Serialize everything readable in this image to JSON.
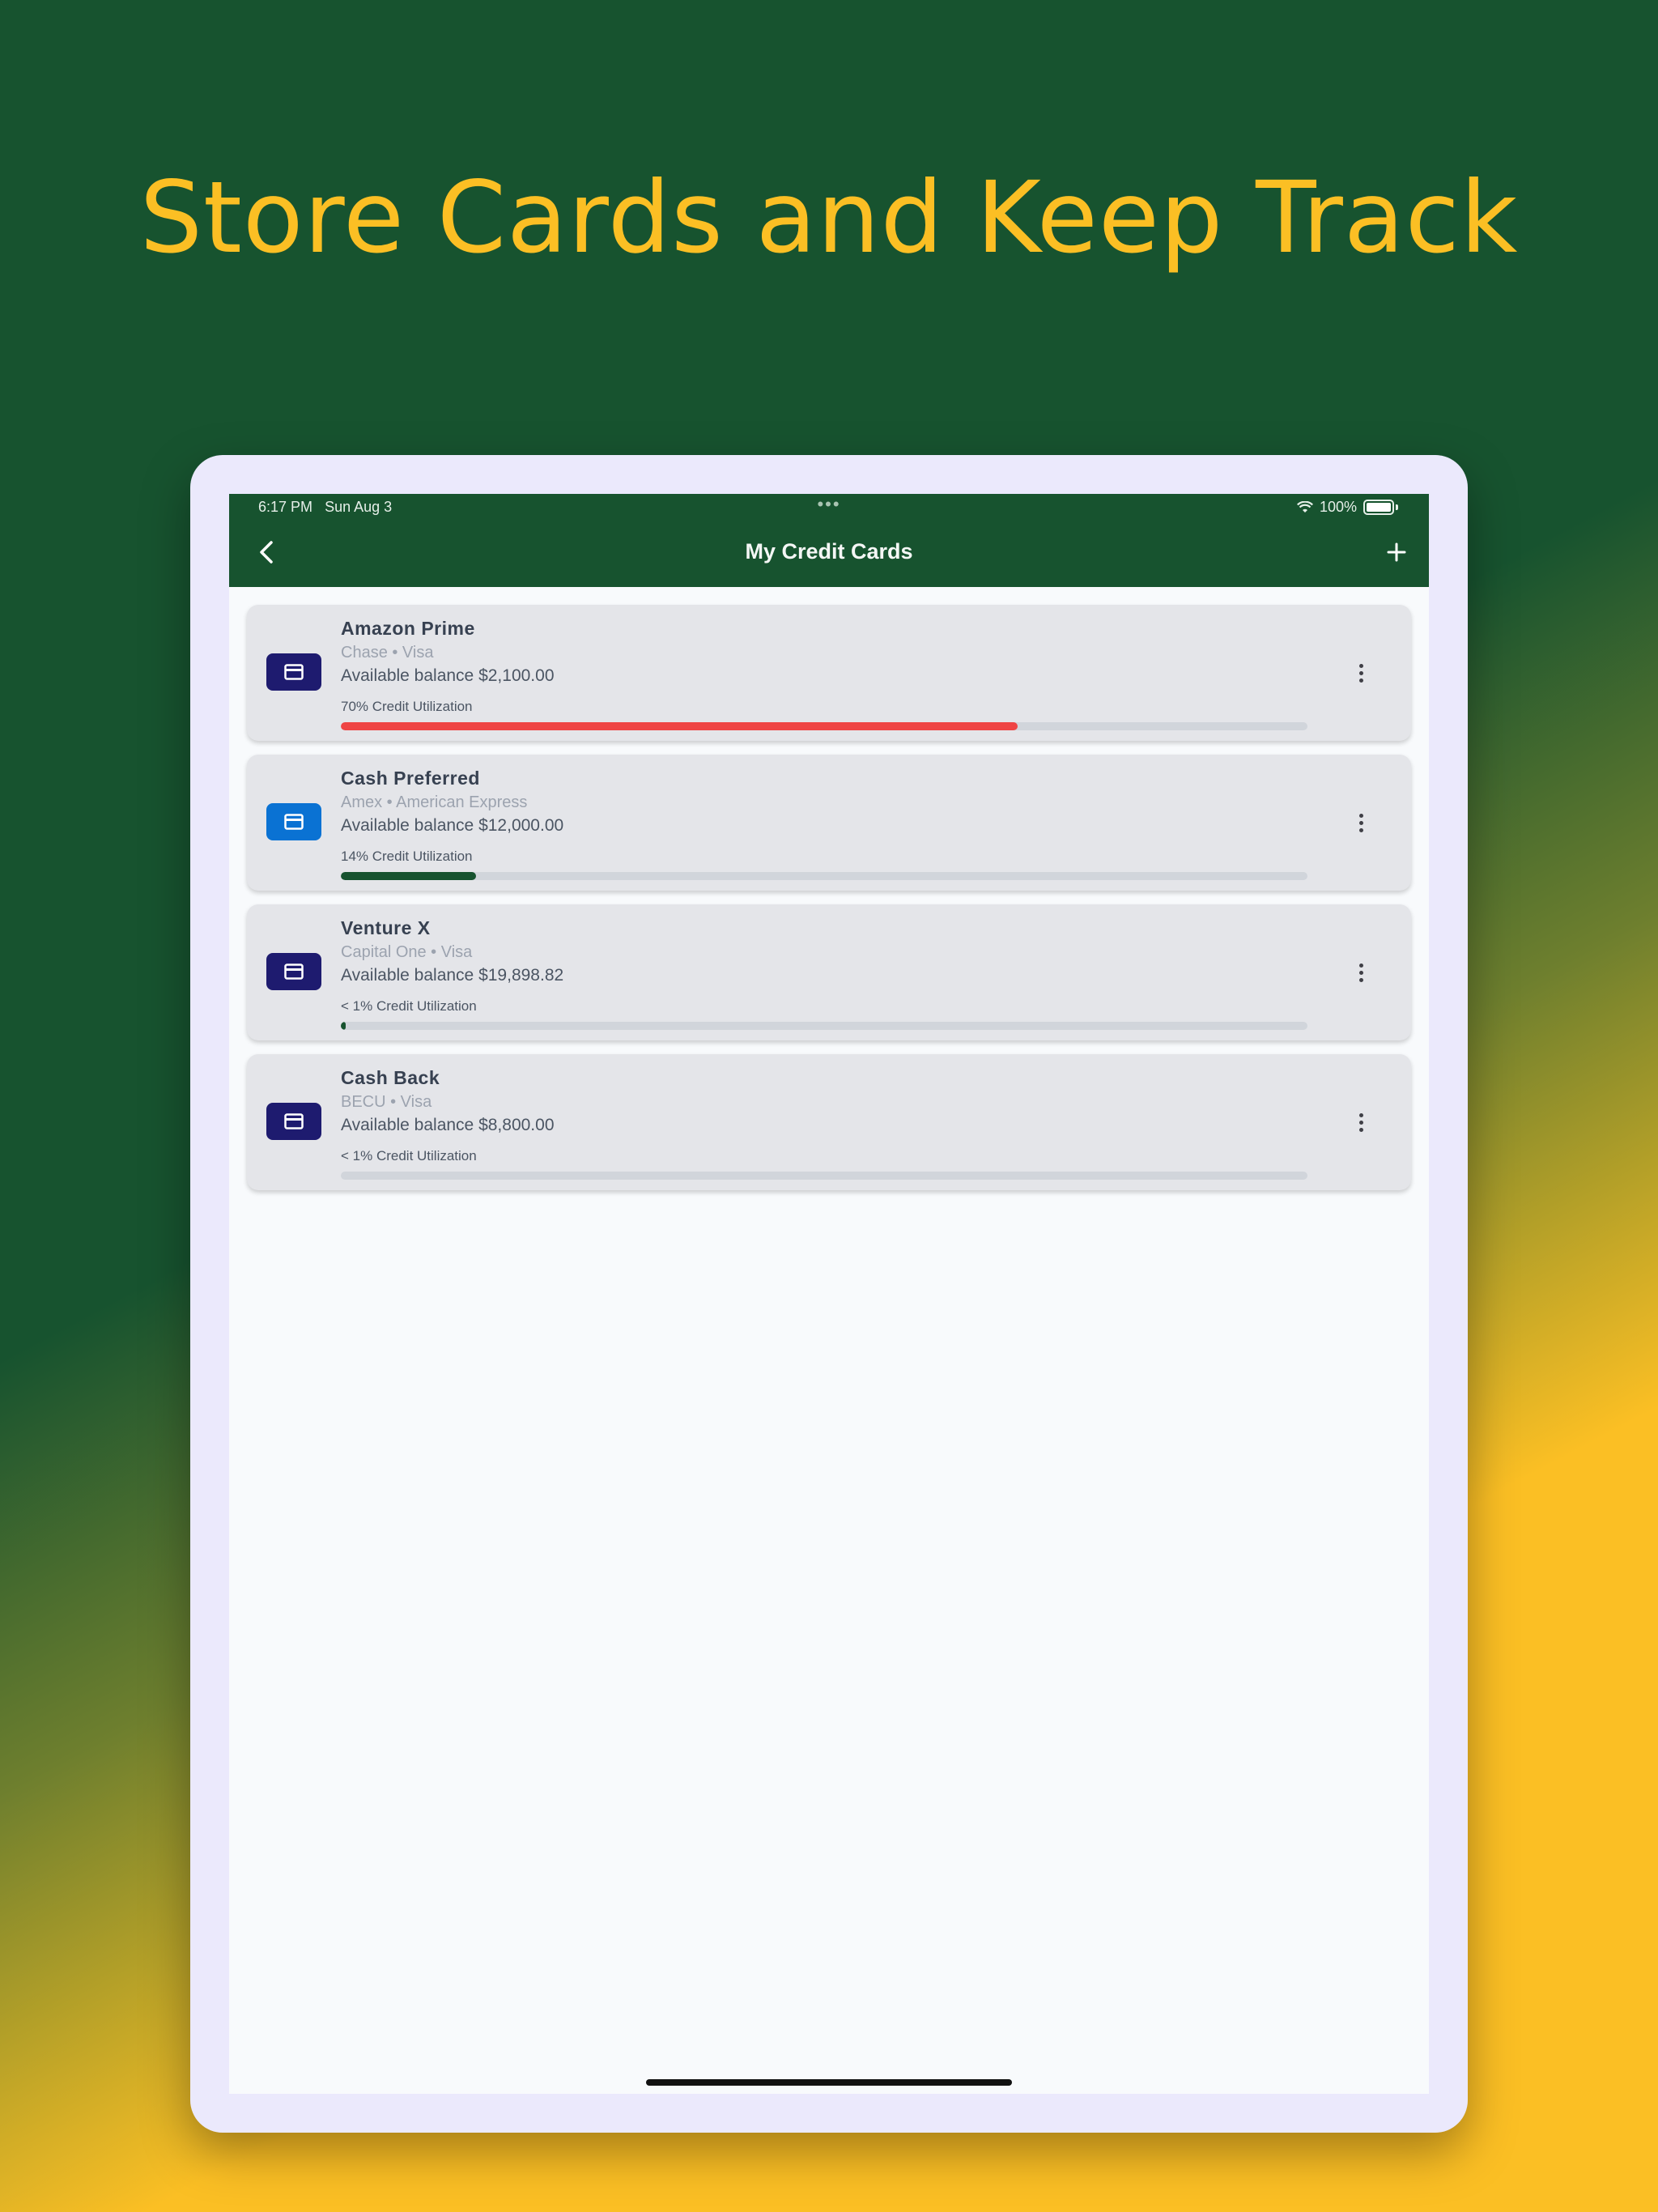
{
  "headline": "Store Cards and Keep Track",
  "status": {
    "time": "6:17 PM",
    "date": "Sun Aug 3",
    "battery": "100%"
  },
  "appbar": {
    "title": "My Credit Cards"
  },
  "colors": {
    "background_green": "#17532f",
    "accent_yellow": "#fbbf24",
    "high_util_red": "#ef4444",
    "low_util_green": "#17532f",
    "visa_icon_bg": "#1e1b6f",
    "amex_icon_bg": "#0a72d3"
  },
  "cards": [
    {
      "name": "Amazon Prime",
      "subtitle": "Chase • Visa",
      "balance": "Available balance $2,100.00",
      "utilization_label": "70% Credit Utilization",
      "utilization": 0.7,
      "icon": "credit-card-icon"
    },
    {
      "name": "Cash Preferred",
      "subtitle": "Amex • American Express",
      "balance": "Available balance $12,000.00",
      "utilization_label": "14% Credit Utilization",
      "utilization": 0.14,
      "icon": "credit-card-icon"
    },
    {
      "name": "Venture X",
      "subtitle": "Capital One • Visa",
      "balance": "Available balance $19,898.82",
      "utilization_label": "< 1% Credit Utilization",
      "utilization": 0.005,
      "icon": "credit-card-icon"
    },
    {
      "name": "Cash Back",
      "subtitle": "BECU • Visa",
      "balance": "Available balance $8,800.00",
      "utilization_label": "< 1% Credit Utilization",
      "utilization": 0.0,
      "icon": "credit-card-icon"
    }
  ]
}
